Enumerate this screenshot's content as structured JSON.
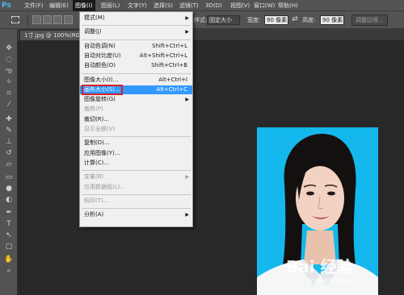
{
  "app": {
    "logo": "Ps"
  },
  "menubar": {
    "items": [
      "文件(F)",
      "编辑(E)",
      "图像(I)",
      "图层(L)",
      "文字(Y)",
      "选择(S)",
      "滤镜(T)",
      "3D(D)",
      "视图(V)",
      "窗口(W)",
      "帮助(H)"
    ],
    "active_index": 2
  },
  "options": {
    "feather_label": "羽化:",
    "feather_value": "0 像素",
    "antialias_label": "消除锯齿",
    "style_label": "样式:",
    "style_value": "固定大小",
    "width_label": "宽度:",
    "width_value": "90 像素",
    "height_label": "高度:",
    "height_value": "90 像素",
    "refine_edge_button": "调整边缘..."
  },
  "document": {
    "tab_title": "1寸.jpg @ 100%(RGB/8)"
  },
  "image_menu": {
    "groups": [
      [
        {
          "label": "模式(M)",
          "shortcut": "",
          "submenu": true,
          "disabled": false
        }
      ],
      [
        {
          "label": "调整(J)",
          "shortcut": "",
          "submenu": true,
          "disabled": false
        }
      ],
      [
        {
          "label": "自动色调(N)",
          "shortcut": "Shift+Ctrl+L",
          "submenu": false,
          "disabled": false
        },
        {
          "label": "自动对比度(U)",
          "shortcut": "Alt+Shift+Ctrl+L",
          "submenu": false,
          "disabled": false
        },
        {
          "label": "自动颜色(O)",
          "shortcut": "Shift+Ctrl+B",
          "submenu": false,
          "disabled": false
        }
      ],
      [
        {
          "label": "图像大小(I)...",
          "shortcut": "Alt+Ctrl+I",
          "submenu": false,
          "disabled": false
        },
        {
          "label": "画布大小(S)...",
          "shortcut": "Alt+Ctrl+C",
          "submenu": false,
          "disabled": false,
          "highlighted": true
        },
        {
          "label": "图像旋转(G)",
          "shortcut": "",
          "submenu": true,
          "disabled": false
        },
        {
          "label": "裁剪(P)",
          "shortcut": "",
          "submenu": false,
          "disabled": true
        },
        {
          "label": "裁切(R)...",
          "shortcut": "",
          "submenu": false,
          "disabled": false
        },
        {
          "label": "显示全部(V)",
          "shortcut": "",
          "submenu": false,
          "disabled": true
        }
      ],
      [
        {
          "label": "复制(D)...",
          "shortcut": "",
          "submenu": false,
          "disabled": false
        },
        {
          "label": "应用图像(Y)...",
          "shortcut": "",
          "submenu": false,
          "disabled": false
        },
        {
          "label": "计算(C)...",
          "shortcut": "",
          "submenu": false,
          "disabled": false
        }
      ],
      [
        {
          "label": "变量(B)",
          "shortcut": "",
          "submenu": true,
          "disabled": true
        },
        {
          "label": "应用数据组(L)...",
          "shortcut": "",
          "submenu": false,
          "disabled": true
        }
      ],
      [
        {
          "label": "陷印(T)...",
          "shortcut": "",
          "submenu": false,
          "disabled": true
        }
      ],
      [
        {
          "label": "分析(A)",
          "shortcut": "",
          "submenu": true,
          "disabled": false
        }
      ]
    ]
  },
  "watermark": {
    "text": "Bai 经验",
    "subtext": "jingyan.baidu.com"
  },
  "colors": {
    "photo_background": "#14b8ec",
    "highlight": "#3399ff",
    "annotation_box": "#d81f26"
  }
}
